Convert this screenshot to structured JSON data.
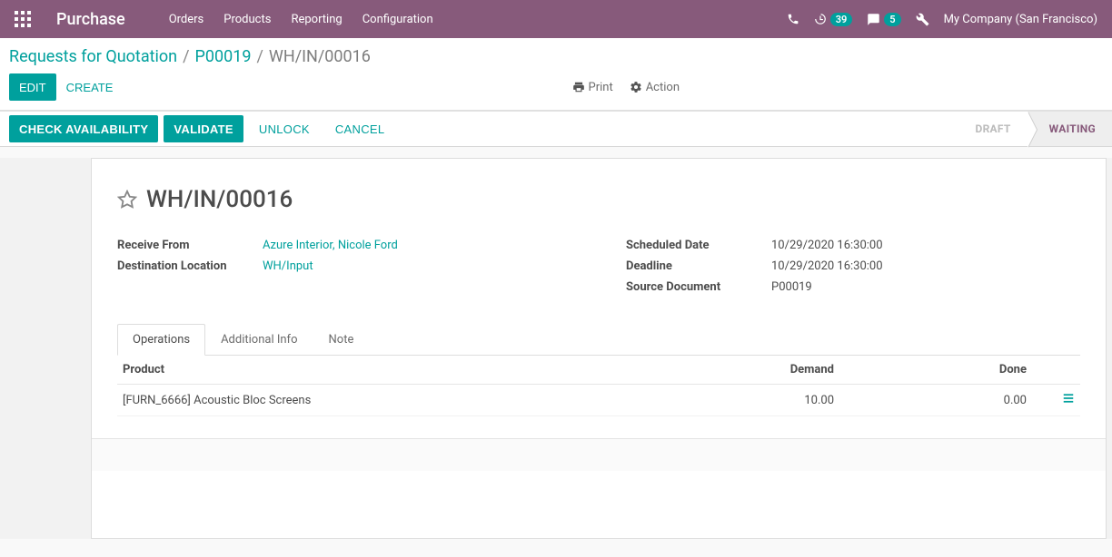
{
  "header": {
    "brand": "Purchase",
    "menu": [
      "Orders",
      "Products",
      "Reporting",
      "Configuration"
    ],
    "activity_count": "39",
    "message_count": "5",
    "company": "My Company (San Francisco)"
  },
  "breadcrumb": {
    "root": "Requests for Quotation",
    "parent": "P00019",
    "current": "WH/IN/00016"
  },
  "cp": {
    "edit": "EDIT",
    "create": "CREATE",
    "print": "Print",
    "action": "Action"
  },
  "statusbar": {
    "check_availability": "CHECK AVAILABILITY",
    "validate": "VALIDATE",
    "unlock": "UNLOCK",
    "cancel": "CANCEL",
    "steps": [
      "DRAFT",
      "WAITING"
    ]
  },
  "record": {
    "title": "WH/IN/00016",
    "receive_from_label": "Receive From",
    "receive_from_value": "Azure Interior, Nicole Ford",
    "destination_label": "Destination Location",
    "destination_value": "WH/Input",
    "scheduled_label": "Scheduled Date",
    "scheduled_value": "10/29/2020 16:30:00",
    "deadline_label": "Deadline",
    "deadline_value": "10/29/2020 16:30:00",
    "source_label": "Source Document",
    "source_value": "P00019"
  },
  "tabs": [
    "Operations",
    "Additional Info",
    "Note"
  ],
  "table": {
    "headers": {
      "product": "Product",
      "demand": "Demand",
      "done": "Done"
    },
    "rows": [
      {
        "product": "[FURN_6666] Acoustic Bloc Screens",
        "demand": "10.00",
        "done": "0.00"
      }
    ]
  }
}
